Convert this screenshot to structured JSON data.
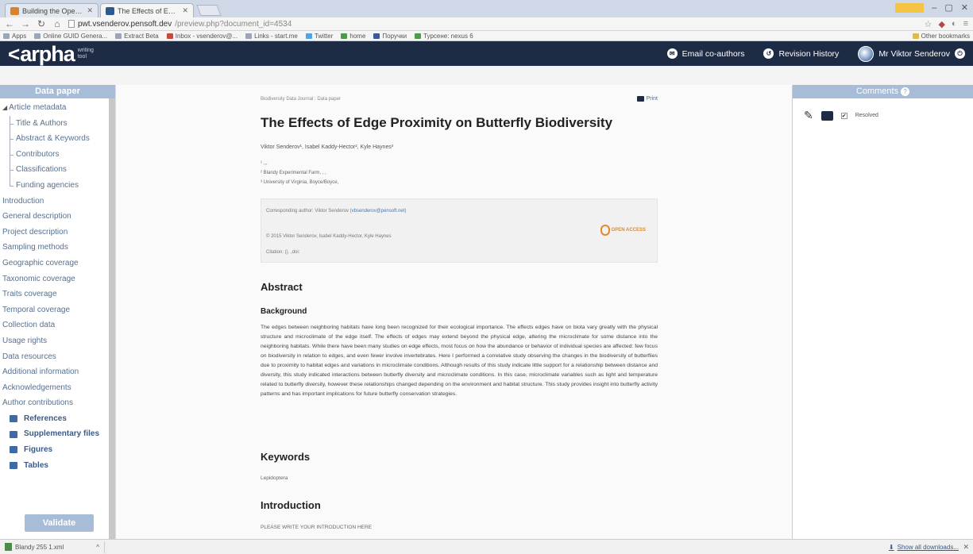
{
  "browser": {
    "tabs": [
      {
        "title": "Building the Open Biodi...",
        "active": false
      },
      {
        "title": "The Effects of Edge Proxi...",
        "active": true
      }
    ],
    "url_host": "pwt.vsenderov.pensoft.dev",
    "url_path": "/preview.php?document_id=4534",
    "bookmarks": [
      "Apps",
      "Online GUID Genera...",
      "Extract Beta",
      "Inbox - vsenderov@...",
      "Links - start.me",
      "Twitter",
      "home",
      "Поручки",
      "Турсене: nexus 6"
    ],
    "other_bookmarks": "Other bookmarks"
  },
  "appbar": {
    "brand": "arpha",
    "sub": "writing tool",
    "email": "Email co-authors",
    "history": "Revision History",
    "user": "Mr Viktor Senderov"
  },
  "sidebar": {
    "header": "Data paper",
    "metadata": "Article metadata",
    "metadata_children": [
      "Title & Authors",
      "Abstract & Keywords",
      "Contributors",
      "Classifications",
      "Funding agencies"
    ],
    "sections": [
      "Introduction",
      "General description",
      "Project description",
      "Sampling methods",
      "Geographic coverage",
      "Taxonomic coverage",
      "Traits coverage",
      "Temporal coverage",
      "Collection data",
      "Usage rights",
      "Data resources",
      "Additional information",
      "Acknowledgements",
      "Author contributions"
    ],
    "resources": [
      "References",
      "Supplementary files",
      "Figures",
      "Tables"
    ],
    "validate": "Validate"
  },
  "document": {
    "journal": "Biodiversity Data Journal : Data paper",
    "print": "Print",
    "title": "The Effects of Edge Proximity on Butterfly Biodiversity",
    "authors": "Viktor Senderov¹, Isabel Kaddy-Hector², Kyle Haynes³",
    "affil": [
      "¹ ,,,",
      "² Blandy Experimental Farm, , ,",
      "³ University of Virginia, Boyce/Boyce,"
    ],
    "corresponding": "Corresponding author: Viktor Senderov (",
    "corresponding_email": "vbsenderov@pensoft.net",
    "corresponding_end": ")",
    "copyright": "© 2015 Viktor Senderov, Isabel Kaddy-Hector, Kyle Haynes",
    "citation": "Citation: (). ,doi:",
    "open_access": "OPEN ACCESS",
    "abstract_heading": "Abstract",
    "background_heading": "Background",
    "background_text": "The edges between neighboring habitats have long been recognized for their ecological importance. The effects edges have on biota vary greatly with the physical structure and microclimate of the edge itself. The effects of edges may extend beyond the physical edge, altering the microclimate for some distance into the neighboring habitats. While there have been many studies on edge effects, most focus on how the abundance or behavior of individual species are affected: few focus on biodiversity in relation to edges, and even fewer involve invertebrates. Here I performed a correlative study observing the changes in the biodiversity of butterflies due to proximity to habitat edges and variations in microclimate conditions. Although results of this study indicate little support for a relationship between distance and diversity, this study indicated interactions between butterfly diversity and microclimate conditions. In this case, microclimate variables such as light and temperature related to butterfly diversity, however these relationships changed depending on the environment and habitat structure. This study provides insight into butterfly activity patterns and has important implications for future butterfly conservation strategies.",
    "keywords_heading": "Keywords",
    "keywords": "Lepidoptera",
    "intro_heading": "Introduction",
    "intro_text": "PLEASE WRITE YOUR INTRODUCTION HERE"
  },
  "comments": {
    "header": "Comments",
    "resolved": "Resolved"
  },
  "statusbar": {
    "download": "Blandy 255 1.xml",
    "show_all": "Show all downloads..."
  }
}
